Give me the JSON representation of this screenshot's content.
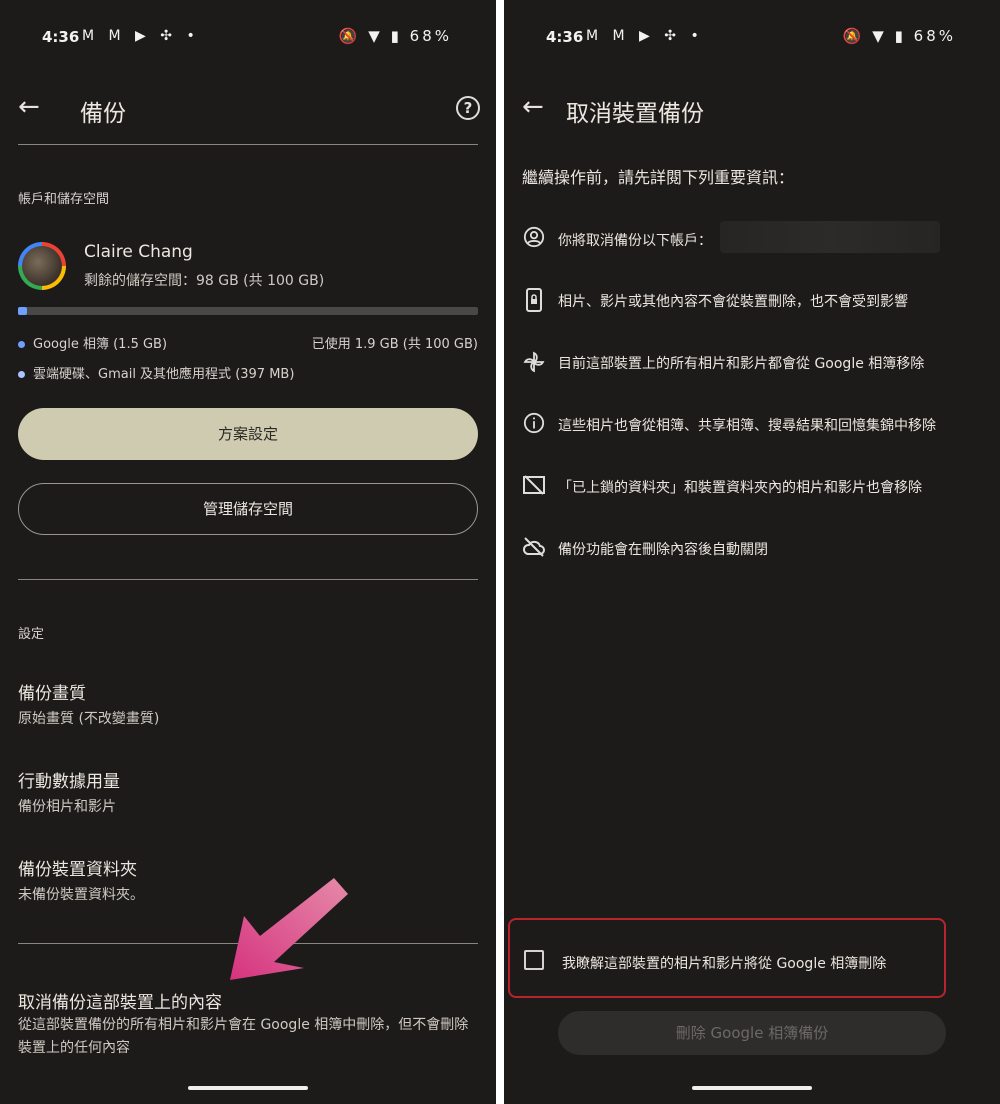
{
  "status_bar": {
    "time": "4:36",
    "left_icons": "M M ▶ ✣ •",
    "right_icons": "🔕 ▼ ▮",
    "battery": "68%"
  },
  "left": {
    "title": "備份",
    "account_section_label": "帳戶和儲存空間",
    "account_name": "Claire Chang",
    "storage_remaining": "剩餘的儲存空間：98 GB (共 100 GB)",
    "storage_used_fraction": 0.019,
    "legend": [
      {
        "label": "Google 相簿 (1.5 GB)",
        "color": "#6ea0ff"
      },
      {
        "label": "雲端硬碟、Gmail 及其他應用程式 (397 MB)",
        "color": "#aac4ff"
      }
    ],
    "used_text": "已使用 1.9 GB (共 100 GB)",
    "plan_button": "方案設定",
    "manage_button": "管理儲存空間",
    "settings_label": "設定",
    "settings": [
      {
        "title": "備份畫質",
        "subtitle": "原始畫質 (不改變畫質)"
      },
      {
        "title": "行動數據用量",
        "subtitle": "備份相片和影片"
      },
      {
        "title": "備份裝置資料夾",
        "subtitle": "未備份裝置資料夾。"
      }
    ],
    "cancel_title": "取消備份這部裝置上的內容",
    "cancel_desc": "從這部裝置備份的所有相片和影片會在 Google 相簿中刪除，但不會刪除裝置上的任何內容",
    "arrow_color": "#d6337f"
  },
  "right": {
    "title": "取消裝置備份",
    "intro": "繼續操作前，請先詳閱下列重要資訊：",
    "items": [
      {
        "icon": "account-circle-icon",
        "text": "你將取消備份以下帳戶："
      },
      {
        "icon": "phone-lock-icon",
        "text": "相片、影片或其他內容不會從裝置刪除，也不會受到影響"
      },
      {
        "icon": "pinwheel-icon",
        "text": "目前這部裝置上的所有相片和影片都會從 Google 相簿移除"
      },
      {
        "icon": "info-icon",
        "text": "這些相片也會從相簿、共享相簿、搜尋結果和回憶集錦中移除"
      },
      {
        "icon": "folder-off-icon",
        "text": "「已上鎖的資料夾」和裝置資料夾內的相片和影片也會移除"
      },
      {
        "icon": "cloud-off-icon",
        "text": "備份功能會在刪除內容後自動關閉"
      }
    ],
    "confirm_text": "我瞭解這部裝置的相片和影片將從 Google 相簿刪除",
    "delete_button": "刪除 Google 相簿備份",
    "highlight_color": "#b8242e"
  }
}
